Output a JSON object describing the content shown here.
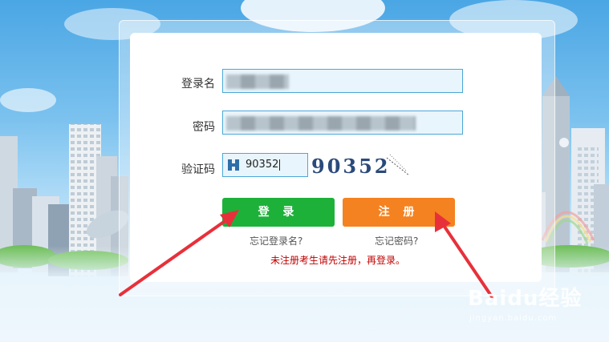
{
  "form": {
    "username_label": "登录名",
    "password_label": "密码",
    "captcha_label": "验证码",
    "captcha_value": "90352",
    "captcha_image_text": "90352"
  },
  "buttons": {
    "login_label": "登 录",
    "register_label": "注 册"
  },
  "links": {
    "forgot_username": "忘记登录名?",
    "forgot_password": "忘记密码?"
  },
  "notice": "未注册考生请先注册，再登录。",
  "watermark": {
    "brand": "Baidu经验",
    "url": "jingyan.baidu.com"
  },
  "colors": {
    "login_button": "#1db13a",
    "register_button": "#f58220",
    "input_border": "#4aa8d8",
    "notice_text": "#c00000",
    "arrow": "#e8303a"
  }
}
